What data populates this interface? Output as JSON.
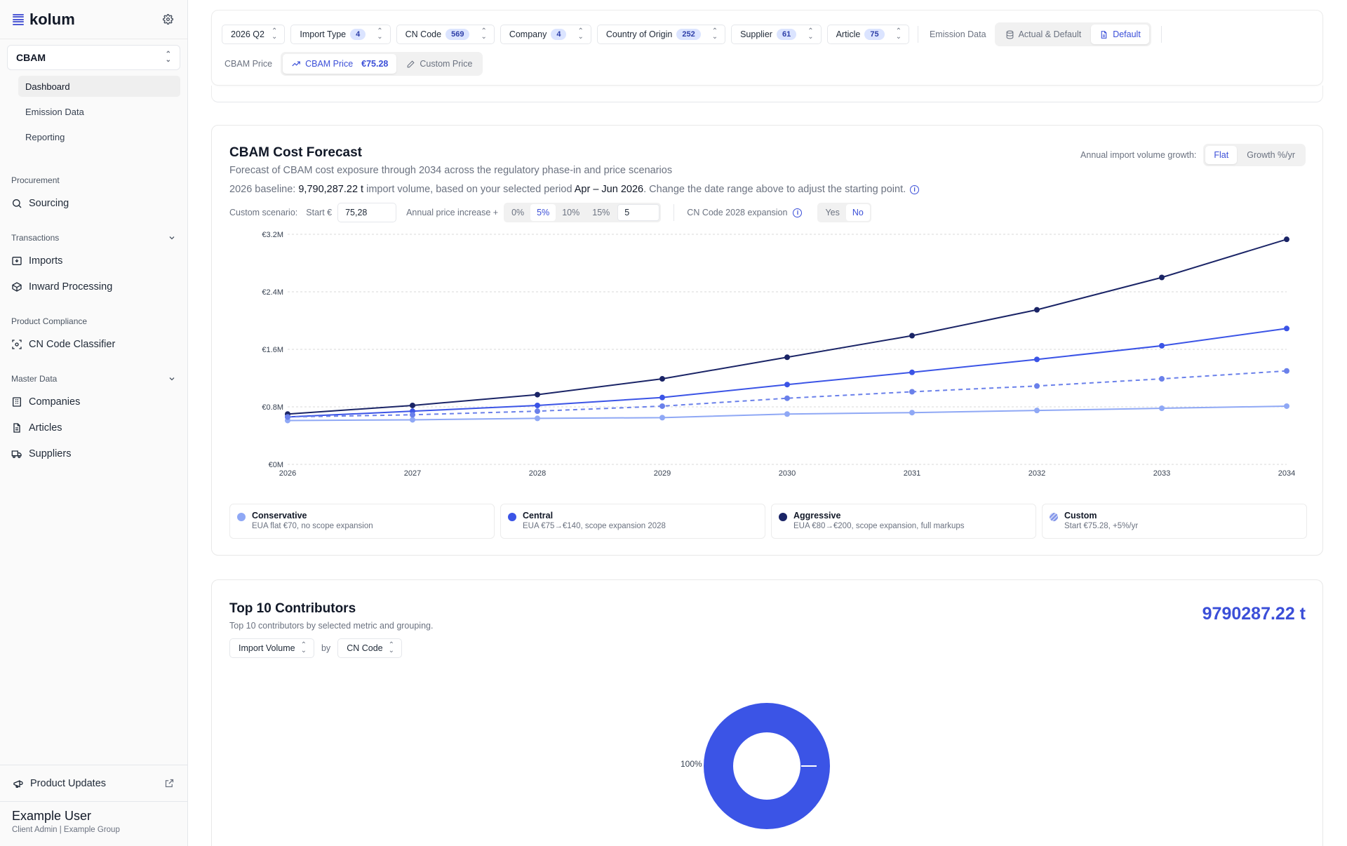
{
  "app": {
    "name": "kolum"
  },
  "sidebar": {
    "module": "CBAM",
    "subnav": [
      {
        "label": "Dashboard",
        "active": true
      },
      {
        "label": "Emission Data",
        "active": false
      },
      {
        "label": "Reporting",
        "active": false
      }
    ],
    "sections": [
      {
        "title": "Procurement",
        "collapsible": false,
        "items": [
          {
            "label": "Sourcing",
            "icon": "search-icon"
          }
        ]
      },
      {
        "title": "Transactions",
        "collapsible": true,
        "items": [
          {
            "label": "Imports",
            "icon": "inbox-icon"
          },
          {
            "label": "Inward Processing",
            "icon": "package-icon"
          }
        ]
      },
      {
        "title": "Product Compliance",
        "collapsible": false,
        "items": [
          {
            "label": "CN Code Classifier",
            "icon": "scan-icon"
          }
        ]
      },
      {
        "title": "Master Data",
        "collapsible": true,
        "items": [
          {
            "label": "Companies",
            "icon": "building-icon"
          },
          {
            "label": "Articles",
            "icon": "document-icon"
          },
          {
            "label": "Suppliers",
            "icon": "truck-icon"
          }
        ]
      }
    ],
    "footer": {
      "product_updates": "Product Updates",
      "user_name": "Example User",
      "user_role": "Client Admin | Example Group"
    }
  },
  "filters": {
    "period": "2026 Q2",
    "chips": [
      {
        "label": "Import Type",
        "count": "4"
      },
      {
        "label": "CN Code",
        "count": "569"
      },
      {
        "label": "Company",
        "count": "4"
      },
      {
        "label": "Country of Origin",
        "count": "252"
      },
      {
        "label": "Supplier",
        "count": "61"
      },
      {
        "label": "Article",
        "count": "75"
      }
    ],
    "emission_label": "Emission Data",
    "emission_options": [
      {
        "label": "Actual & Default",
        "active": false
      },
      {
        "label": "Default",
        "active": true
      }
    ],
    "price_label": "CBAM Price",
    "price_options": {
      "cbam": "CBAM Price",
      "cbam_value": "€75.28",
      "custom": "Custom Price"
    }
  },
  "forecast": {
    "title": "CBAM Cost Forecast",
    "subtitle": "Forecast of CBAM cost exposure through 2034 across the regulatory phase-in and price scenarios",
    "baseline_prefix": "2026 baseline: ",
    "baseline_volume": "9,790,287.22 t",
    "baseline_middle": " import volume, based on your selected period ",
    "baseline_period": "Apr – Jun 2026",
    "baseline_suffix": ". Change the date range above to adjust the starting point.",
    "growth_label": "Annual import volume growth:",
    "growth_options": [
      "Flat",
      "Growth %/yr"
    ],
    "custom_scenario_label": "Custom scenario:",
    "start_label": "Start €",
    "start_value": "75,28",
    "increase_label": "Annual price increase +",
    "increase_options": [
      "0%",
      "5%",
      "10%",
      "15%"
    ],
    "increase_value": "5",
    "expansion_label": "CN Code 2028 expansion",
    "expansion_options": [
      "Yes",
      "No"
    ],
    "legend": [
      {
        "name": "Conservative",
        "desc": "EUA flat €70, no scope expansion",
        "color": "#8fa8f5"
      },
      {
        "name": "Central",
        "desc": "EUA €75→€140, scope expansion 2028",
        "color": "#3b54e6"
      },
      {
        "name": "Aggressive",
        "desc": "EUA €80→€200, scope expansion, full markups",
        "color": "#1a2466"
      },
      {
        "name": "Custom",
        "desc": "Start €75.28, +5%/yr",
        "color": "#7f92e8"
      }
    ]
  },
  "chart_data": {
    "type": "line",
    "x": [
      2026,
      2027,
      2028,
      2029,
      2030,
      2031,
      2032,
      2033,
      2034
    ],
    "y_ticks": [
      "€0M",
      "€0.8M",
      "€1.6M",
      "€2.4M",
      "€3.2M"
    ],
    "ylim": [
      0,
      3.2
    ],
    "grid": true,
    "series": [
      {
        "name": "Conservative",
        "color": "#8fa8f5",
        "dashed": false,
        "values": [
          0.61,
          0.62,
          0.64,
          0.65,
          0.7,
          0.72,
          0.75,
          0.78,
          0.81
        ]
      },
      {
        "name": "Central",
        "color": "#3b54e6",
        "dashed": false,
        "values": [
          0.66,
          0.74,
          0.82,
          0.93,
          1.11,
          1.28,
          1.46,
          1.65,
          1.89
        ]
      },
      {
        "name": "Aggressive",
        "color": "#1a2466",
        "dashed": false,
        "values": [
          0.7,
          0.82,
          0.97,
          1.19,
          1.49,
          1.79,
          2.15,
          2.6,
          3.13
        ]
      },
      {
        "name": "Custom",
        "color": "#6a80ea",
        "dashed": true,
        "values": [
          0.66,
          0.69,
          0.74,
          0.81,
          0.92,
          1.01,
          1.09,
          1.19,
          1.3
        ]
      }
    ]
  },
  "contributors": {
    "title": "Top 10 Contributors",
    "subtitle": "Top 10 contributors by selected metric and grouping.",
    "total": "9790287.22 t",
    "metric": "Import Volume",
    "by_label": "by",
    "grouping": "CN Code",
    "pie_label": "100%",
    "pie_color": "#3b54e6"
  }
}
